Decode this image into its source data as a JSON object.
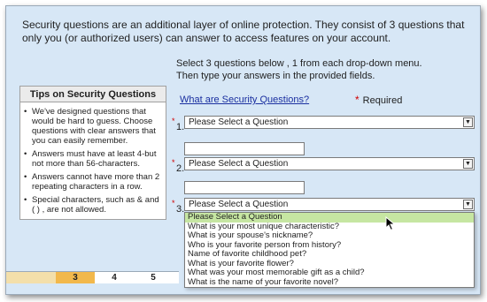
{
  "intro_text": "Security questions are an additional layer of online protection. They consist of 3 questions that only you (or authorized users) can answer to access features on your account.",
  "instructions": {
    "line1": "Select 3 questions below , 1 from each drop-down menu.",
    "line2": "Then type your answers in the provided fields."
  },
  "what_link": "What are Security Questions?",
  "required_label": "Required",
  "tips": {
    "title": "Tips on Security Questions",
    "items": [
      "We've designed questions that would be hard to guess. Choose questions with clear answers that you can easily remember.",
      "Answers must have at least 4-but not more than 56-characters.",
      "Answers cannot have more than 2 repeating characters in a row.",
      "Special characters, such as & and ( ) , are not allowed."
    ]
  },
  "questions": [
    {
      "number": "1.",
      "selected": "Please Select a Question",
      "answer": ""
    },
    {
      "number": "2.",
      "selected": "Please Select a Question",
      "answer": ""
    },
    {
      "number": "3.",
      "selected": "Please Select a Question"
    }
  ],
  "dropdown_options": [
    "Please Select a Question",
    "What is your most unique characteristic?",
    "What is your spouse's nickname?",
    "Who is your favorite person from history?",
    "Name of favorite childhood pet?",
    "What is your favorite flower?",
    "What was your most memorable gift as a child?",
    "What is the name of your favorite novel?"
  ],
  "pager": [
    "3",
    "4",
    "5"
  ],
  "colors": {
    "background": "#d7e7f6",
    "active_page": "#f2b84b",
    "highlight_option": "#c6e6a2",
    "required_star": "#d00000",
    "link": "#1a2fa0"
  }
}
